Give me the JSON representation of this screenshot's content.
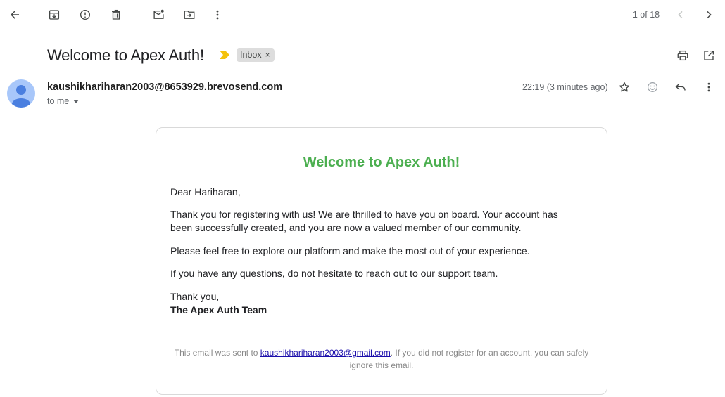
{
  "toolbar": {
    "back_icon": "arrow-left-icon",
    "archive_icon": "archive-icon",
    "spam_icon": "report-spam-icon",
    "delete_icon": "trash-icon",
    "mark_unread_icon": "mark-unread-icon",
    "move_icon": "move-to-folder-icon",
    "more_icon": "more-vert-icon",
    "pager_text": "1 of 18",
    "older_icon": "chevron-left-icon",
    "newer_icon": "chevron-right-icon"
  },
  "subject_row": {
    "subject": "Welcome to Apex Auth!",
    "importance_icon": "importance-marker-icon",
    "label": "Inbox",
    "label_remove": "×",
    "print_icon": "print-icon",
    "new_window_icon": "open-in-new-icon"
  },
  "sender_row": {
    "sender": "kaushikhariharan2003@8653929.brevosend.com",
    "recipient": "to me",
    "timestamp": "22:19 (3 minutes ago)",
    "star_icon": "star-icon",
    "emoji_icon": "emoji-reaction-icon",
    "reply_icon": "reply-icon",
    "more_icon": "more-vert-icon"
  },
  "email": {
    "title": "Welcome to Apex Auth!",
    "greeting": "Dear Hariharan,",
    "para1": "Thank you for registering with us! We are thrilled to have you on board. Your account has been successfully created, and you are now a valued member of our community.",
    "para2": "Please feel free to explore our platform and make the most out of your experience.",
    "para3": "If you have any questions, do not hesitate to reach out to our support team.",
    "closing": "Thank you,",
    "signature": "The Apex Auth Team",
    "footer_prefix": "This email was sent to ",
    "footer_email": "kaushikhariharan2003@gmail.com",
    "footer_suffix": ". If you did not register for an account, you can safely ignore this email."
  },
  "colors": {
    "title_green": "#4caf50",
    "importance_yellow": "#f4c20d",
    "avatar_bg": "#a8c7fa",
    "avatar_fg": "#4a7fe0",
    "link_blue": "#1a0dab"
  }
}
